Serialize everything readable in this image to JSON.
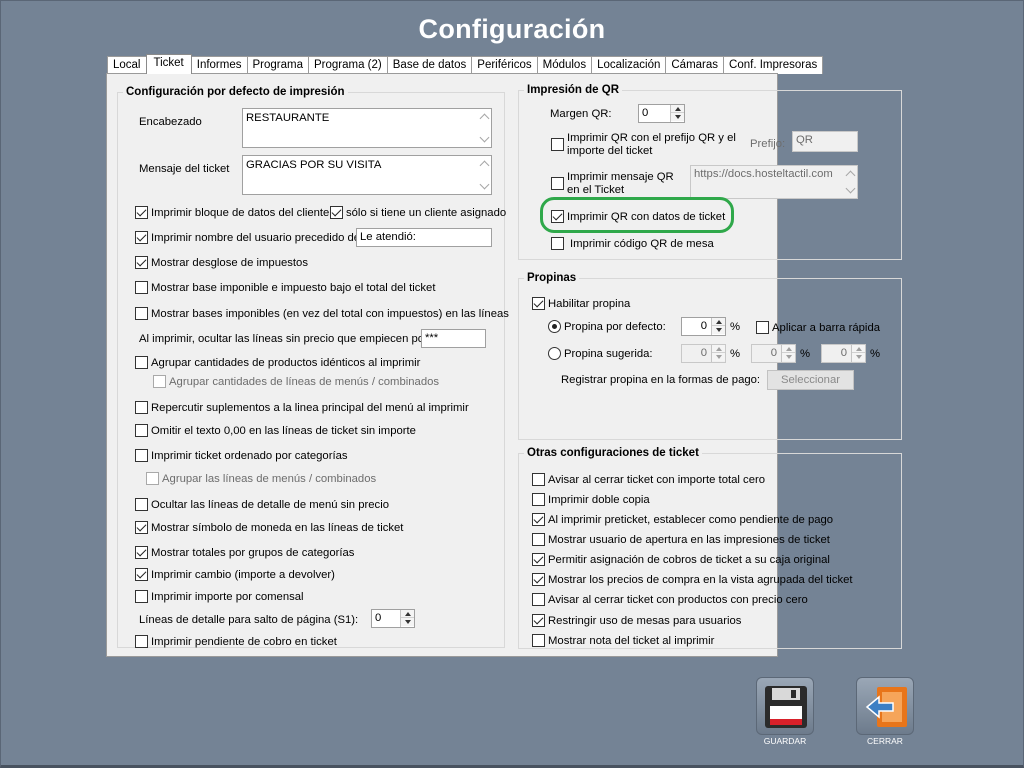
{
  "title": "Configuración",
  "tabs": [
    "Local",
    "Ticket",
    "Informes",
    "Programa",
    "Programa (2)",
    "Base de datos",
    "Periféricos",
    "Módulos",
    "Localización",
    "Cámaras",
    "Conf. Impresoras"
  ],
  "print_defaults": {
    "title": "Configuración por defecto de impresión",
    "header_label": "Encabezado",
    "header_value": "RESTAURANTE",
    "message_label": "Mensaje del ticket",
    "message_value": "GRACIAS POR SU VISITA",
    "print_client_block": "Imprimir bloque de datos del cliente",
    "only_if_client": "sólo si tiene un cliente asignado",
    "print_user_name": "Imprimir nombre del usuario precedido de:",
    "user_prefix_value": "Le atendió:",
    "show_tax_breakdown": "Mostrar desglose de impuestos",
    "print_tax_base": "Mostrar base imponible e impuesto bajo el total del ticket",
    "show_tax_bases_lines": "Mostrar bases imponibles (en vez del total con impuestos) en las líneas",
    "hide_lines_label": "Al imprimir, ocultar las líneas sin precio que empiecen por:",
    "hide_lines_value": "***",
    "group_identical": "Agrupar cantidades de productos idénticos al imprimir",
    "group_menu_lines": "Agrupar cantidades de líneas de menús / combinados",
    "pass_supplements": "Repercutir suplementos a la linea principal del menú al imprimir",
    "omit_zero_text": "Omitir el texto 0,00 en las líneas de ticket sin importe",
    "print_by_category": "Imprimir ticket ordenado por categorías",
    "group_menu_lines_2": "Agrupar las líneas de menús / combinados",
    "hide_menu_detail": "Ocultar las líneas de detalle de menú sin precio",
    "show_currency": "Mostrar símbolo de moneda en las líneas de ticket",
    "show_category_totals": "Mostrar totales por grupos de categorías",
    "print_change": "Imprimir cambio (importe a devolver)",
    "print_per_diner": "Imprimir importe por comensal",
    "page_break_label": "Líneas de detalle para salto de página (S1):",
    "page_break_value": "0",
    "print_pending": "Imprimir pendiente de cobro en ticket"
  },
  "qr": {
    "title": "Impresión de QR",
    "margin_label": "Margen QR:",
    "margin_value": "0",
    "prefix_option": "Imprimir QR con el prefijo QR y el importe del ticket",
    "prefix_label": "Prefijo:",
    "prefix_value": "QR",
    "message_option": "Imprimir mensaje QR en el Ticket",
    "message_url": "https://docs.hosteltactil.com",
    "ticket_data_option": "Imprimir QR con datos de ticket",
    "table_code_option": "Imprimir código QR de mesa"
  },
  "tips": {
    "title": "Propinas",
    "enable": "Habilitar propina",
    "default_tip": "Propina por defecto:",
    "default_value": "0",
    "pct": "%",
    "quick_bar": "Aplicar a barra rápida",
    "suggested_tip": "Propina sugerida:",
    "suggested_1": "0",
    "suggested_2": "0",
    "suggested_3": "0",
    "register_label": "Registrar propina en la formas de pago:",
    "select_button": "Seleccionar"
  },
  "other": {
    "title": "Otras configuraciones de ticket",
    "items": [
      {
        "label": "Avisar al cerrar ticket con importe total cero",
        "checked": false
      },
      {
        "label": "Imprimir doble copia",
        "checked": false
      },
      {
        "label": "Al imprimir preticket, establecer como pendiente de pago",
        "checked": true
      },
      {
        "label": "Mostrar usuario de apertura en las impresiones de ticket",
        "checked": false
      },
      {
        "label": "Permitir asignación de cobros de ticket a su caja original",
        "checked": true
      },
      {
        "label": "Mostrar los precios de compra en la vista agrupada del ticket",
        "checked": true
      },
      {
        "label": "Avisar al cerrar ticket con productos con precio cero",
        "checked": false
      },
      {
        "label": "Restringir uso de mesas para usuarios",
        "checked": true
      },
      {
        "label": "Mostrar nota del ticket al imprimir",
        "checked": false
      }
    ]
  },
  "footer": {
    "save_label": "GUARDAR",
    "close_label": "CERRAR"
  },
  "colors": {
    "background": "#748395",
    "highlight": "#2fa84a",
    "save_accent": "#d8202a",
    "close_accent": "#e8751a"
  }
}
